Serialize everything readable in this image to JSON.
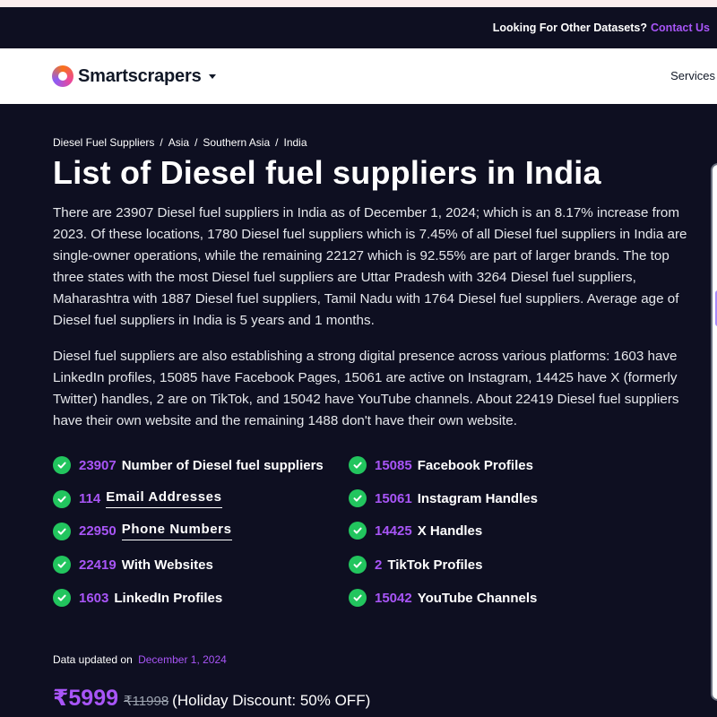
{
  "topbar": {
    "text": "Looking For Other Datasets?",
    "link": "Contact Us"
  },
  "nav": {
    "brand": "Smartscrapers",
    "services": "Services"
  },
  "breadcrumb": [
    "Diesel Fuel Suppliers",
    "Asia",
    "Southern Asia",
    "India"
  ],
  "page_title": "List of Diesel fuel suppliers in India",
  "paragraphs": [
    "There are 23907 Diesel fuel suppliers in India as of December 1, 2024; which is an 8.17% increase from 2023. Of these locations, 1780 Diesel fuel suppliers which is 7.45% of all Diesel fuel suppliers in India are single-owner operations, while the remaining 22127 which is 92.55% are part of larger brands. The top three states with the most Diesel fuel suppliers are Uttar Pradesh with 3264 Diesel fuel suppliers, Maharashtra with 1887 Diesel fuel suppliers, Tamil Nadu with 1764 Diesel fuel suppliers. Average age of Diesel fuel suppliers in India is 5 years and 1 months.",
    "Diesel fuel suppliers are also establishing a strong digital presence across various platforms: 1603 have LinkedIn profiles, 15085 have Facebook Pages, 15061 are active on Instagram, 14425 have X (formerly Twitter) handles, 2 are on TikTok, and 15042 have YouTube channels. About 22419 Diesel fuel suppliers have their own website and the remaining 1488 don't have their own website."
  ],
  "stats": {
    "left": [
      {
        "value": "23907",
        "label": "Number of Diesel fuel suppliers"
      },
      {
        "value": "114",
        "label": "Email Addresses"
      },
      {
        "value": "22950",
        "label": "Phone Numbers"
      },
      {
        "value": "22419",
        "label": "With Websites"
      },
      {
        "value": "1603",
        "label": "LinkedIn Profiles"
      }
    ],
    "right": [
      {
        "value": "15085",
        "label": "Facebook Profiles"
      },
      {
        "value": "15061",
        "label": "Instagram Handles"
      },
      {
        "value": "14425",
        "label": "X Handles"
      },
      {
        "value": "2",
        "label": "TikTok Profiles"
      },
      {
        "value": "15042",
        "label": "YouTube Channels"
      }
    ]
  },
  "updated": {
    "label": "Data updated on",
    "date": "December 1, 2024"
  },
  "pricing": {
    "price": "₹5999",
    "original": "₹11998",
    "discount": "(Holiday Discount: 50% OFF)"
  },
  "colors": {
    "accent": "#a855f7",
    "background": "#0e0f21",
    "check": "#22c55e"
  }
}
